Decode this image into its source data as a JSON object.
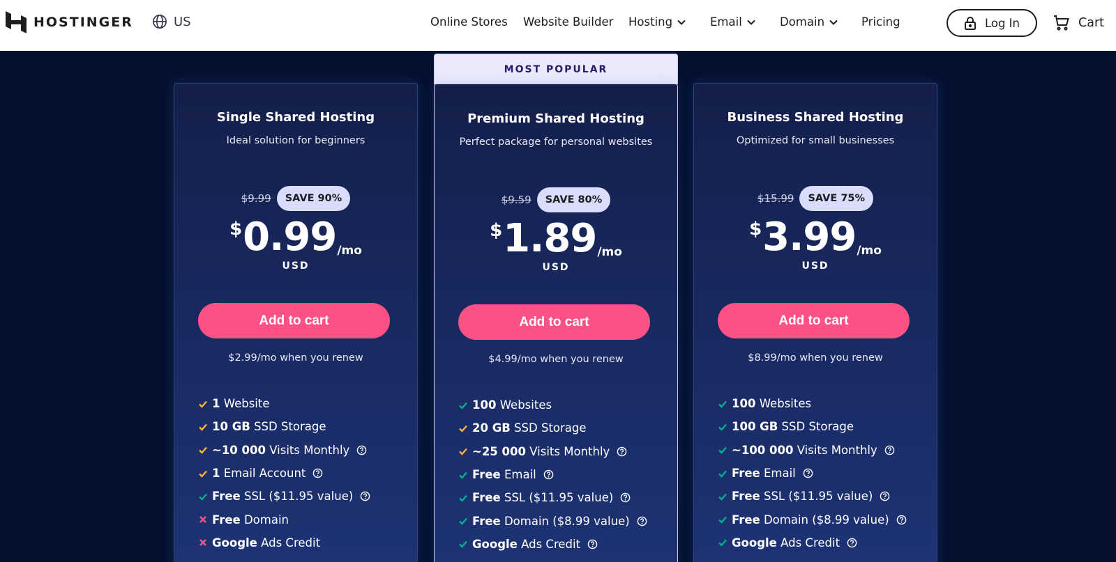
{
  "header": {
    "brand": "HOSTINGER",
    "region": "US",
    "nav": [
      {
        "label": "Online Stores",
        "dropdown": false
      },
      {
        "label": "Website Builder",
        "dropdown": false
      },
      {
        "label": "Hosting",
        "dropdown": true
      },
      {
        "label": "Email",
        "dropdown": true
      },
      {
        "label": "Domain",
        "dropdown": true
      },
      {
        "label": "Pricing",
        "dropdown": false
      }
    ],
    "login_label": "Log In",
    "cart_label": "Cart"
  },
  "popular_label": "MOST POPULAR",
  "colors": {
    "accent_pink": "#fc5185",
    "check_green": "#00b090",
    "check_orange": "#ffb238",
    "cross_red": "#fc5185",
    "card_bg": "#1a2a63",
    "page_bg": "#03102f"
  },
  "plans": [
    {
      "name": "Single Shared Hosting",
      "desc": "Ideal solution for beginners",
      "old_price": "$9.99",
      "save": "SAVE 90%",
      "currency": "$",
      "price": "0.99",
      "period": "/mo",
      "currency_code": "USD",
      "cta": "Add to cart",
      "renew": "$2.99/mo when you renew",
      "features": [
        {
          "bold": "1",
          "text": " Website",
          "icon": "check-orange",
          "help": false
        },
        {
          "bold": "10 GB",
          "text": " SSD Storage",
          "icon": "check-orange",
          "help": false
        },
        {
          "bold": "~10 000",
          "text": " Visits Monthly",
          "icon": "check-orange",
          "help": true
        },
        {
          "bold": "1",
          "text": " Email Account",
          "icon": "check-orange",
          "help": true
        },
        {
          "bold": "Free",
          "text": " SSL ($11.95 value)",
          "icon": "check-green",
          "help": true
        },
        {
          "bold": "Free",
          "text": " Domain",
          "icon": "cross",
          "help": false
        },
        {
          "bold": "Google",
          "text": " Ads Credit",
          "icon": "cross",
          "help": false
        }
      ]
    },
    {
      "name": "Premium Shared Hosting",
      "desc": "Perfect package for personal websites",
      "old_price": "$9.59",
      "save": "SAVE 80%",
      "currency": "$",
      "price": "1.89",
      "period": "/mo",
      "currency_code": "USD",
      "cta": "Add to cart",
      "renew": "$4.99/mo when you renew",
      "features": [
        {
          "bold": "100",
          "text": " Websites",
          "icon": "check-green",
          "help": false
        },
        {
          "bold": "20 GB",
          "text": " SSD Storage",
          "icon": "check-orange",
          "help": false
        },
        {
          "bold": "~25 000",
          "text": " Visits Monthly",
          "icon": "check-orange",
          "help": true
        },
        {
          "bold": "Free",
          "text": " Email",
          "icon": "check-green",
          "help": true
        },
        {
          "bold": "Free",
          "text": " SSL ($11.95 value)",
          "icon": "check-green",
          "help": true
        },
        {
          "bold": "Free",
          "text": " Domain ($8.99 value)",
          "icon": "check-green",
          "help": true
        },
        {
          "bold": "Google",
          "text": " Ads Credit",
          "icon": "check-green",
          "help": true
        }
      ]
    },
    {
      "name": "Business Shared Hosting",
      "desc": "Optimized for small businesses",
      "old_price": "$15.99",
      "save": "SAVE 75%",
      "currency": "$",
      "price": "3.99",
      "period": "/mo",
      "currency_code": "USD",
      "cta": "Add to cart",
      "renew": "$8.99/mo when you renew",
      "features": [
        {
          "bold": "100",
          "text": " Websites",
          "icon": "check-green",
          "help": false
        },
        {
          "bold": "100 GB",
          "text": " SSD Storage",
          "icon": "check-green",
          "help": false
        },
        {
          "bold": "~100 000",
          "text": " Visits Monthly",
          "icon": "check-green",
          "help": true
        },
        {
          "bold": "Free",
          "text": " Email",
          "icon": "check-green",
          "help": true
        },
        {
          "bold": "Free",
          "text": " SSL ($11.95 value)",
          "icon": "check-green",
          "help": true
        },
        {
          "bold": "Free",
          "text": " Domain ($8.99 value)",
          "icon": "check-green",
          "help": true
        },
        {
          "bold": "Google",
          "text": " Ads Credit",
          "icon": "check-green",
          "help": true
        }
      ]
    }
  ]
}
